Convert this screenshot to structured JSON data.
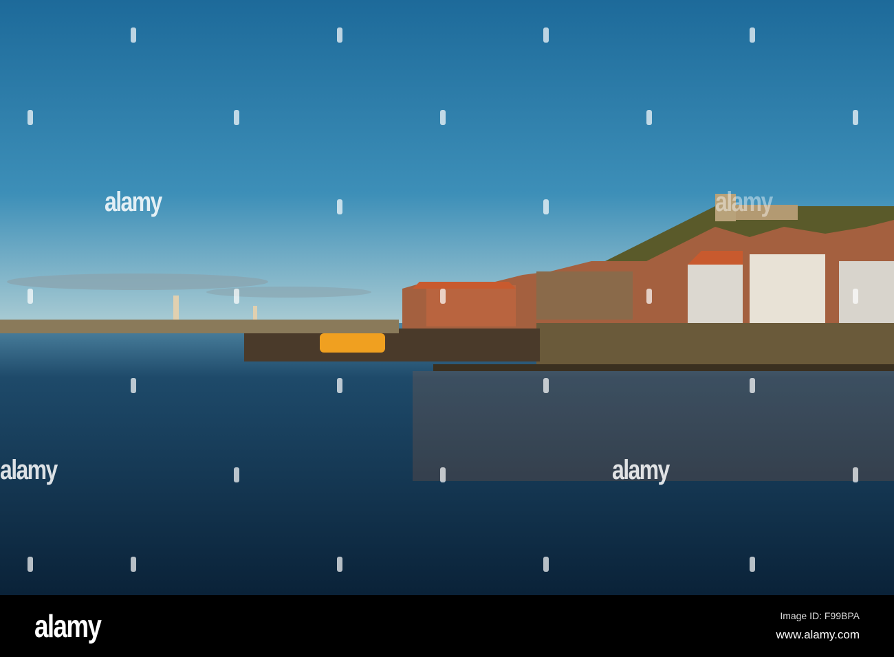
{
  "watermark": {
    "brand": "alamy"
  },
  "footer": {
    "logo": "alamy",
    "image_id": "Image ID: F99BPA",
    "url": "www.alamy.com"
  }
}
